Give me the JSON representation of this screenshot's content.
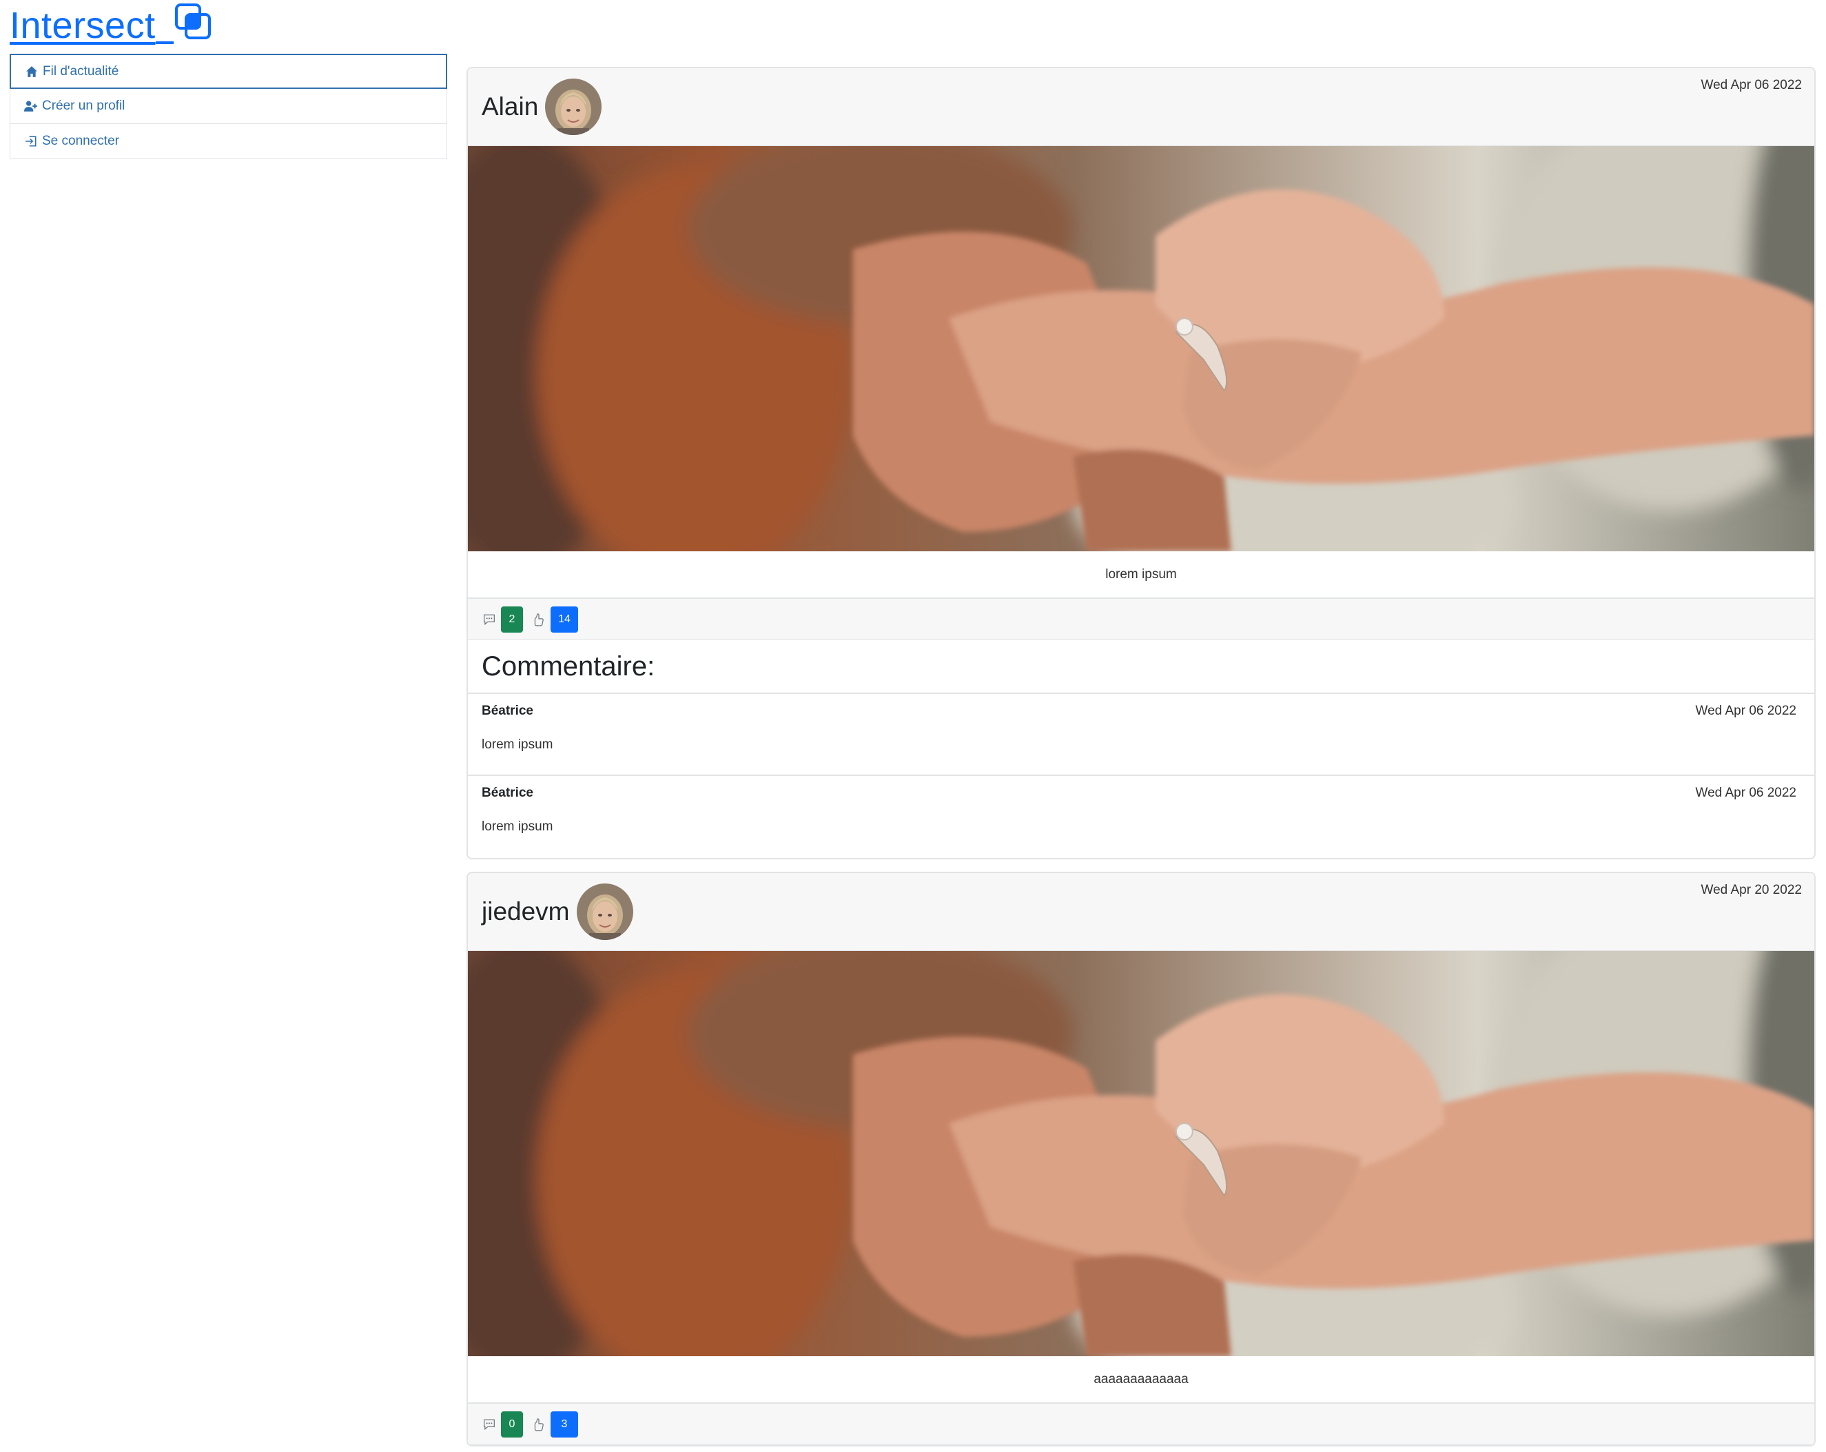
{
  "brand": {
    "name": "Intersect",
    "icon": "intersect-icon",
    "color": "#0d6efd"
  },
  "sidebar": {
    "items": [
      {
        "label": "Fil d'actualité",
        "icon": "home-icon",
        "active": true
      },
      {
        "label": "Créer un profil",
        "icon": "user-plus-icon",
        "active": false
      },
      {
        "label": "Se connecter",
        "icon": "login-icon",
        "active": false
      }
    ]
  },
  "posts": [
    {
      "author": "Alain",
      "date": "Wed Apr 06 2022",
      "caption": "lorem ipsum",
      "comment_count": "2",
      "like_count": "14",
      "comments_title": "Commentaire:",
      "comments": [
        {
          "author": "Béatrice",
          "date": "Wed Apr 06 2022",
          "text": "lorem ipsum"
        },
        {
          "author": "Béatrice",
          "date": "Wed Apr 06 2022",
          "text": "lorem ipsum"
        }
      ]
    },
    {
      "author": "jiedevm",
      "date": "Wed Apr 20 2022",
      "caption": "aaaaaaaaaaaaa",
      "comment_count": "0",
      "like_count": "3"
    }
  ],
  "colors": {
    "comment_badge": "#198754",
    "like_badge": "#0d6efd",
    "link": "#2f6fae"
  }
}
